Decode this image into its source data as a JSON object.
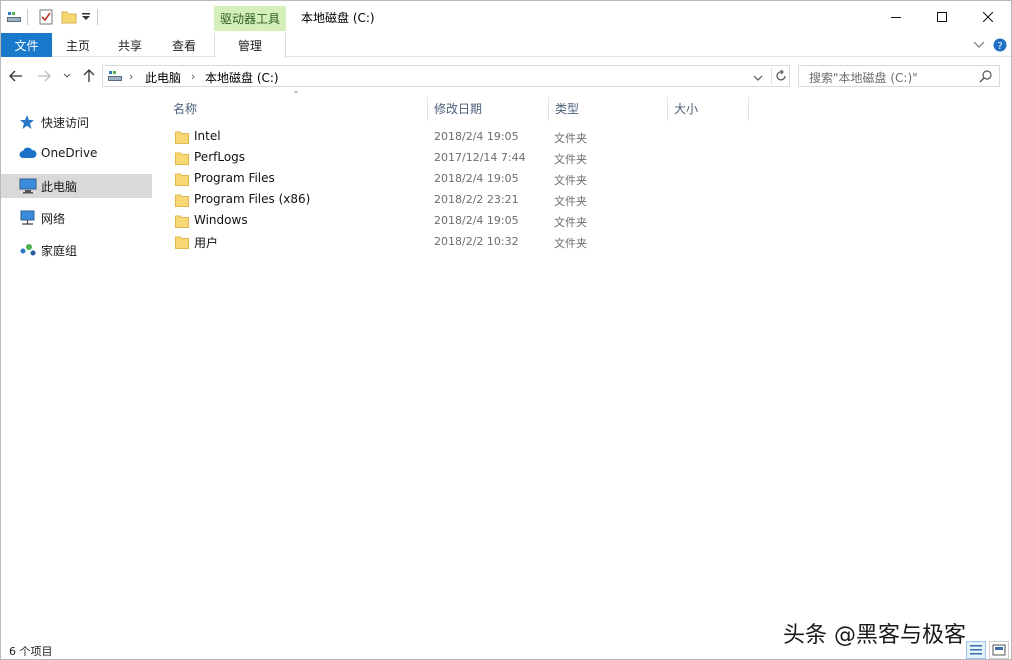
{
  "titlebar": {
    "context_tab": "驱动器工具",
    "title": "本地磁盘 (C:)"
  },
  "ribbon": {
    "tabs": [
      "文件",
      "主页",
      "共享",
      "查看",
      "管理"
    ]
  },
  "address": {
    "crumbs": [
      "此电脑",
      "本地磁盘 (C:)"
    ],
    "search_placeholder": "搜索\"本地磁盘 (C:)\""
  },
  "nav": {
    "items": [
      {
        "label": "快速访问",
        "icon": "star-icon"
      },
      {
        "label": "OneDrive",
        "icon": "cloud-icon"
      },
      {
        "label": "此电脑",
        "icon": "computer-icon",
        "selected": true
      },
      {
        "label": "网络",
        "icon": "network-icon"
      },
      {
        "label": "家庭组",
        "icon": "homegroup-icon"
      }
    ]
  },
  "columns": [
    "名称",
    "修改日期",
    "类型",
    "大小"
  ],
  "files": [
    {
      "name": "Intel",
      "date": "2018/2/4 19:05",
      "type": "文件夹"
    },
    {
      "name": "PerfLogs",
      "date": "2017/12/14 7:44",
      "type": "文件夹"
    },
    {
      "name": "Program Files",
      "date": "2018/2/4 19:05",
      "type": "文件夹"
    },
    {
      "name": "Program Files (x86)",
      "date": "2018/2/2 23:21",
      "type": "文件夹"
    },
    {
      "name": "Windows",
      "date": "2018/2/4 19:05",
      "type": "文件夹"
    },
    {
      "name": "用户",
      "date": "2018/2/2 10:32",
      "type": "文件夹"
    }
  ],
  "status": {
    "count": "6 个项目"
  },
  "watermark": "头条 @黑客与极客",
  "colors": {
    "file_tab": "#1979ca",
    "context_tab": "#d4efb9",
    "folder": "#f8d775",
    "selected_nav": "#d9d9d9"
  }
}
